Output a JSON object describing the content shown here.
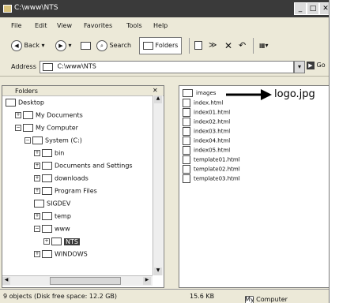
{
  "window": {
    "title": "C:\\www\\NTS"
  },
  "titlebar_buttons": [
    "_",
    "□",
    "✕"
  ],
  "menu": [
    "File",
    "Edit",
    "View",
    "Favorites",
    "Tools",
    "Help"
  ],
  "toolbar": {
    "back_label": "Back",
    "search_label": "Search",
    "folders_label": "Folders",
    "views_label": "▦▾"
  },
  "address": {
    "label": "Address",
    "value": "C:\\www\\NTS",
    "go_label": "Go"
  },
  "tree": {
    "header": "Folders",
    "close_label": "✕",
    "nodes": [
      {
        "label": "Desktop",
        "depth": 0,
        "expand": ""
      },
      {
        "label": "My Documents",
        "depth": 1,
        "expand": "+"
      },
      {
        "label": "My Computer",
        "depth": 1,
        "expand": "−"
      },
      {
        "label": "System (C:)",
        "depth": 2,
        "expand": "−"
      },
      {
        "label": "bin",
        "depth": 3,
        "expand": "+"
      },
      {
        "label": "Documents and Settings",
        "depth": 3,
        "expand": "+"
      },
      {
        "label": "downloads",
        "depth": 3,
        "expand": "+"
      },
      {
        "label": "Program Files",
        "depth": 3,
        "expand": "+"
      },
      {
        "label": "SIGDEV",
        "depth": 3,
        "expand": ""
      },
      {
        "label": "temp",
        "depth": 3,
        "expand": "+"
      },
      {
        "label": "www",
        "depth": 3,
        "expand": "−"
      },
      {
        "label": "NTS",
        "depth": 4,
        "expand": "+",
        "selected": true
      },
      {
        "label": "WINDOWS",
        "depth": 3,
        "expand": "+"
      }
    ]
  },
  "files": [
    {
      "name": "images",
      "type": "folder"
    },
    {
      "name": "index.html",
      "type": "file"
    },
    {
      "name": "index01.html",
      "type": "file"
    },
    {
      "name": "index02.html",
      "type": "file"
    },
    {
      "name": "index03.html",
      "type": "file"
    },
    {
      "name": "index04.html",
      "type": "file"
    },
    {
      "name": "index05.html",
      "type": "file"
    },
    {
      "name": "template01.html",
      "type": "file"
    },
    {
      "name": "template02.html",
      "type": "file"
    },
    {
      "name": "template03.html",
      "type": "file"
    }
  ],
  "callout": {
    "label": "logo.jpg"
  },
  "status": {
    "objects": "9 objects (Disk free space: 12.2 GB)",
    "size": "15.6 KB",
    "location": "My Computer"
  }
}
